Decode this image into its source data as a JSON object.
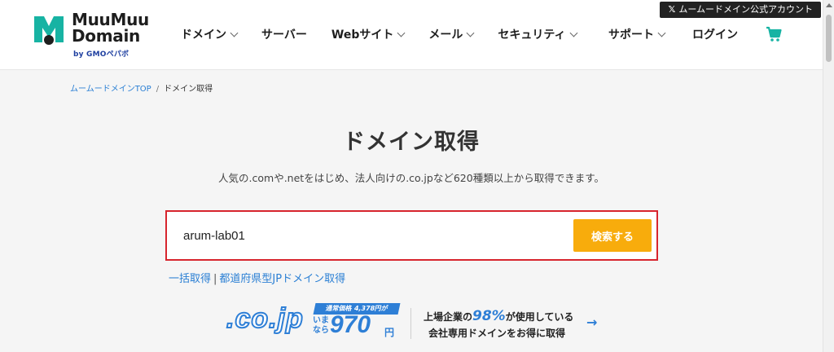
{
  "header": {
    "x_account_label": "ムームードメイン公式アカウント",
    "logo": {
      "line1": "MuuMuu",
      "line2": "Domain",
      "sub": "by GMOペパボ"
    },
    "nav": [
      {
        "label": "ドメイン",
        "dropdown": true
      },
      {
        "label": "サーバー",
        "dropdown": false
      },
      {
        "label": "Webサイト",
        "dropdown": true
      },
      {
        "label": "メール",
        "dropdown": true
      },
      {
        "label": "セキュリティ",
        "dropdown": true
      }
    ],
    "support_label": "サポート",
    "login_label": "ログイン"
  },
  "breadcrumb": {
    "home": "ムームードメインTOP",
    "separator": "/",
    "current": "ドメイン取得"
  },
  "page": {
    "title": "ドメイン取得",
    "subtitle": "人気の.comや.netをはじめ、法人向けの.co.jpなど620種類以上から取得できます。"
  },
  "search": {
    "value": "arum-lab01",
    "button_label": "検索する"
  },
  "links": {
    "bulk": "一括取得",
    "separator": "|",
    "prefecture": "都道府県型JPドメイン取得"
  },
  "banner": {
    "tld": ".co.jp",
    "regular_price": "通常価格 4,378円が",
    "now_label_1": "いま",
    "now_label_2": "なら",
    "price": "970",
    "unit": "円",
    "line1_pre": "上場企業の",
    "line1_pct": "98%",
    "line1_post": "が使用している",
    "line2": "会社専用ドメインをお得に取得"
  },
  "colors": {
    "accent_blue": "#2e7fd6",
    "search_button": "#f8ac0c",
    "search_border": "#d7252e",
    "cart_teal": "#17b3a3"
  }
}
